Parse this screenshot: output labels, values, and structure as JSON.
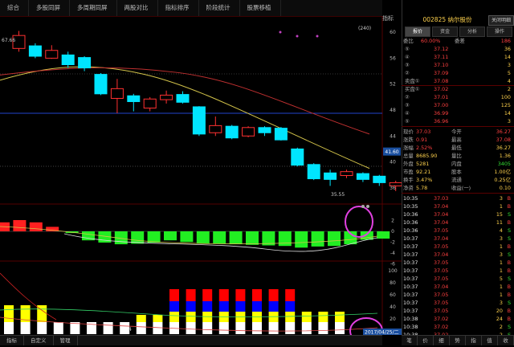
{
  "top_tabs": [
    "综合",
    "多股同屏",
    "多周期同屏",
    "两股对比",
    "指标排序",
    "阶段统计",
    "股票移植"
  ],
  "left_header": "指标",
  "stock_title": "002825 纳尔股份",
  "close_label": "关闭明细",
  "right_tabs": [
    {
      "label": "报价",
      "active": true
    },
    {
      "label": "资金",
      "active": false
    },
    {
      "label": "分析",
      "active": false
    },
    {
      "label": "操作",
      "active": false
    }
  ],
  "order_header": {
    "label": "委比",
    "ratio": "60.00%",
    "diff_label": "委差",
    "diff": "186"
  },
  "asks": [
    {
      "level": "⑤",
      "price": "37.12",
      "vol": "36"
    },
    {
      "level": "④",
      "price": "37.11",
      "vol": "14"
    },
    {
      "level": "③",
      "price": "37.10",
      "vol": "3"
    },
    {
      "level": "②",
      "price": "37.09",
      "vole": "",
      "vol": "5"
    },
    {
      "level": "卖盘①",
      "price": "37.08",
      "vol": "4"
    }
  ],
  "bids": [
    {
      "level": "买盘①",
      "price": "37.02",
      "vol": "2"
    },
    {
      "level": "②",
      "price": "37.01",
      "vol": "100"
    },
    {
      "level": "③",
      "price": "37.00",
      "vol": "125"
    },
    {
      "level": "④",
      "price": "36.99",
      "vol": "14"
    },
    {
      "level": "⑤",
      "price": "36.96",
      "vol": "3"
    }
  ],
  "quote": [
    {
      "k1": "现价",
      "v1": "37.03",
      "k2": "今开",
      "v2": "36.27"
    },
    {
      "k1": "涨跌",
      "v1": "0.91",
      "k2": "最高",
      "v2": "37.08"
    },
    {
      "k1": "涨幅",
      "v1": "2.52%",
      "k2": "最低",
      "v2": "36.27"
    },
    {
      "k1": "总量",
      "v1": "8685.90",
      "k2": "量比",
      "v2": "1.36"
    },
    {
      "k1": "外盘",
      "v1": "5281",
      "k2": "内盘",
      "v2": "3405"
    },
    {
      "k1": "市盈",
      "v1": "92.21",
      "k2": "股本",
      "v2": "1.00亿"
    },
    {
      "k1": "换手",
      "v1": "3.47%",
      "k2": "流通",
      "v2": "0.25亿"
    },
    {
      "k1": "净资",
      "v1": "5.78",
      "k2": "收益(一)",
      "v2": "0.10"
    }
  ],
  "ticks": [
    {
      "t": "10:35",
      "p": "37.03",
      "v": "3",
      "d": "B"
    },
    {
      "t": "10:35",
      "p": "37.04",
      "v": "1",
      "d": "B"
    },
    {
      "t": "10:36",
      "p": "37.04",
      "v": "15",
      "d": "S"
    },
    {
      "t": "10:36",
      "p": "37.04",
      "v": "11",
      "d": "B"
    },
    {
      "t": "10:36",
      "p": "37.05",
      "v": "4",
      "d": "S"
    },
    {
      "t": "10:37",
      "p": "37.04",
      "v": "3",
      "d": "S"
    },
    {
      "t": "10:37",
      "p": "37.05",
      "v": "1",
      "d": "B"
    },
    {
      "t": "10:37",
      "p": "37.04",
      "v": "3",
      "d": "S"
    },
    {
      "t": "10:37",
      "p": "37.05",
      "v": "1",
      "d": "B"
    },
    {
      "t": "10:37",
      "p": "37.05",
      "v": "1",
      "d": "B"
    },
    {
      "t": "10:37",
      "p": "37.05",
      "v": "5",
      "d": "S"
    },
    {
      "t": "10:37",
      "p": "37.04",
      "v": "1",
      "d": "B"
    },
    {
      "t": "10:37",
      "p": "37.05",
      "v": "1",
      "d": "B"
    },
    {
      "t": "10:37",
      "p": "37.05",
      "v": "3",
      "d": "S"
    },
    {
      "t": "10:37",
      "p": "37.05",
      "v": "20",
      "d": "B"
    },
    {
      "t": "10:38",
      "p": "37.02",
      "v": "24",
      "d": "B"
    },
    {
      "t": "10:38",
      "p": "37.02",
      "v": "2",
      "d": "S"
    },
    {
      "t": "10:38",
      "p": "37.02",
      "v": "2",
      "d": "S"
    },
    {
      "t": "10:38",
      "p": "37.03",
      "v": "1",
      "d": "B"
    }
  ],
  "bottom_tabs": [
    "指标",
    "自定义",
    "管理"
  ],
  "right_bottom_tabs": [
    "笔",
    "价",
    "细",
    "势",
    "指",
    "值",
    "收"
  ],
  "main_chart": {
    "price_ticks": [
      "60",
      "56",
      "52",
      "48",
      "44",
      "40",
      "36"
    ],
    "current_price_label": "41.60",
    "high_label": "67.66",
    "low_label": "35.55",
    "indicator_label": "(240)",
    "macd_ticks": [
      "2",
      "0",
      "-2",
      "-4",
      "-6"
    ],
    "vol_ticks": [
      "100",
      "80",
      "60",
      "40",
      "20",
      "0"
    ],
    "date_label": "2017/04/25/二",
    "x_label": "4"
  },
  "chart_data": {
    "type": "candlestick",
    "candles": [
      {
        "o": 57.5,
        "c": 59.5,
        "h": 60.2,
        "l": 57.0
      },
      {
        "o": 57.9,
        "c": 56.3,
        "h": 58.3,
        "l": 56.0
      },
      {
        "o": 56.0,
        "c": 57.2,
        "h": 58.0,
        "l": 55.9
      },
      {
        "o": 56.5,
        "c": 55.0,
        "h": 57.0,
        "l": 54.5
      },
      {
        "o": 56.1,
        "c": 54.5,
        "h": 56.3,
        "l": 54.0
      },
      {
        "o": 53.5,
        "c": 50.5,
        "h": 53.7,
        "l": 50.3
      },
      {
        "o": 49.8,
        "c": 51.3,
        "h": 52.8,
        "l": 47.5
      },
      {
        "o": 50.2,
        "c": 49.3,
        "h": 50.5,
        "l": 47.8
      },
      {
        "o": 48.3,
        "c": 49.7,
        "h": 50.0,
        "l": 47.8
      },
      {
        "o": 49.6,
        "c": 50.3,
        "h": 51.0,
        "l": 49.0
      },
      {
        "o": 50.4,
        "c": 49.2,
        "h": 50.9,
        "l": 49.0
      },
      {
        "o": 48.5,
        "c": 44.3,
        "h": 48.6,
        "l": 44.0
      },
      {
        "o": 44.5,
        "c": 45.6,
        "h": 47.0,
        "l": 44.0
      },
      {
        "o": 45.5,
        "c": 43.7,
        "h": 45.7,
        "l": 43.5
      },
      {
        "o": 44.0,
        "c": 45.3,
        "h": 45.5,
        "l": 43.8
      },
      {
        "o": 45.3,
        "c": 44.5,
        "h": 45.5,
        "l": 44.0
      },
      {
        "o": 45.2,
        "c": 43.4,
        "h": 45.4,
        "l": 43.3
      },
      {
        "o": 42.0,
        "c": 39.5,
        "h": 42.2,
        "l": 39.3
      },
      {
        "o": 39.6,
        "c": 37.4,
        "h": 39.8,
        "l": 37.2
      },
      {
        "o": 38.3,
        "c": 37.3,
        "h": 38.8,
        "l": 36.3
      },
      {
        "o": 37.9,
        "c": 38.5,
        "h": 38.8,
        "l": 37.5
      },
      {
        "o": 38.2,
        "c": 37.3,
        "h": 38.4,
        "l": 36.9
      },
      {
        "o": 37.8,
        "c": 36.8,
        "h": 38.0,
        "l": 36.3
      },
      {
        "o": 36.3,
        "c": 36.8,
        "h": 37.1,
        "l": 35.5
      },
      {
        "o": 36.5,
        "c": 37.1,
        "h": 37.4,
        "l": 36.2
      }
    ],
    "macd": [
      1.6,
      2.0,
      1.6,
      0.8,
      -0.3,
      -1.6,
      -2.0,
      -2.3,
      -2.2,
      -2.0,
      -1.6,
      -1.9,
      -2.2,
      -2.2,
      -2.3,
      -2.4,
      -2.5,
      -2.6,
      -2.9,
      -2.7,
      -2.6,
      -2.3,
      -1.5,
      -1.3
    ],
    "ylim": [
      34,
      62
    ]
  }
}
